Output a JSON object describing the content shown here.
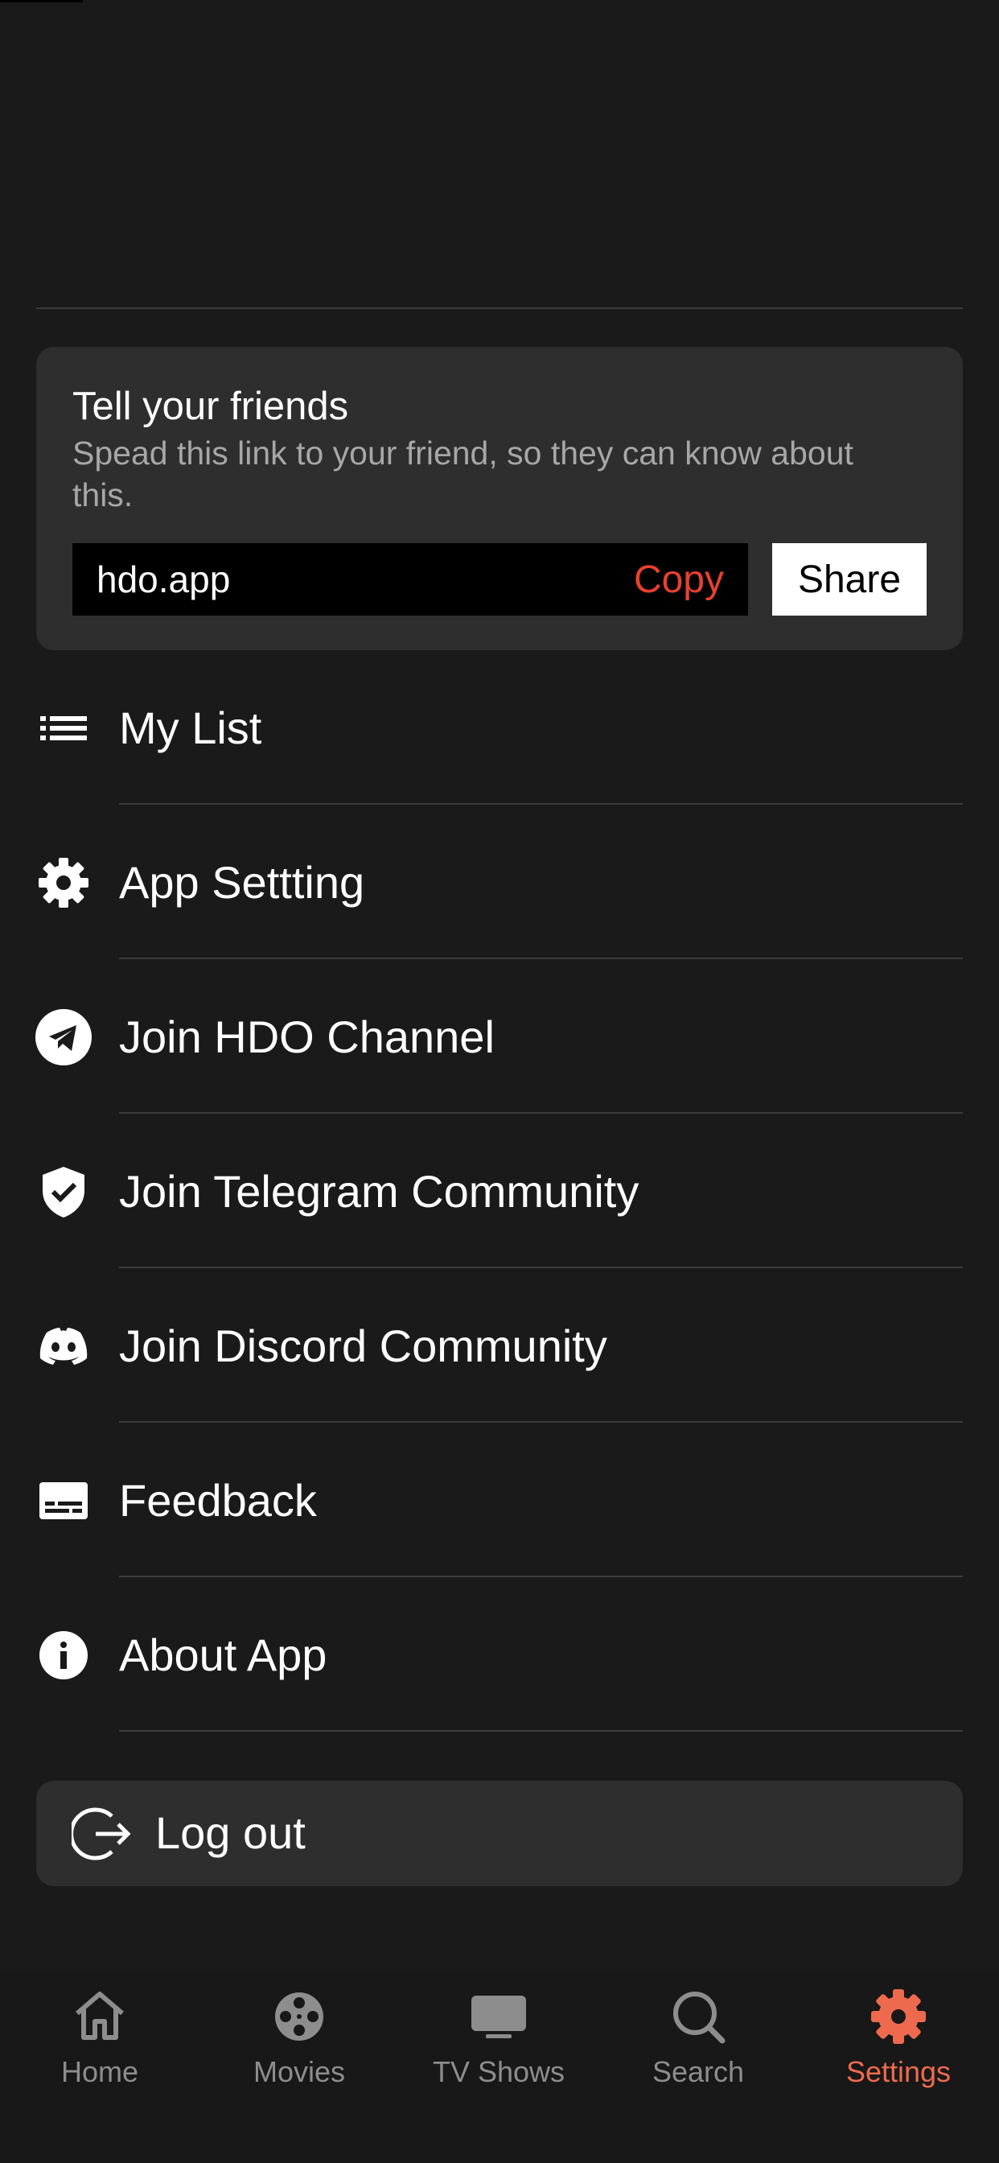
{
  "share_card": {
    "title": "Tell your friends",
    "subtitle": "Spead this link to your friend, so they can know about this.",
    "link": "hdo.app",
    "copy_label": "Copy",
    "share_label": "Share"
  },
  "menu": {
    "items": [
      {
        "label": "My List",
        "icon": "list-icon"
      },
      {
        "label": "App Settting",
        "icon": "gear-icon"
      },
      {
        "label": "Join HDO Channel",
        "icon": "telegram-icon"
      },
      {
        "label": "Join Telegram Community",
        "icon": "shield-check-icon"
      },
      {
        "label": "Join Discord Community",
        "icon": "discord-icon"
      },
      {
        "label": "Feedback",
        "icon": "subtitles-icon"
      },
      {
        "label": "About App",
        "icon": "info-icon"
      }
    ]
  },
  "logout": {
    "label": "Log out",
    "icon": "logout-icon"
  },
  "tabbar": {
    "tabs": [
      {
        "label": "Home",
        "icon": "home-icon",
        "active": false
      },
      {
        "label": "Movies",
        "icon": "film-reel-icon",
        "active": false
      },
      {
        "label": "TV Shows",
        "icon": "tv-icon",
        "active": false
      },
      {
        "label": "Search",
        "icon": "search-icon",
        "active": false
      },
      {
        "label": "Settings",
        "icon": "gear-icon",
        "active": true
      }
    ]
  },
  "colors": {
    "background": "#1a1a1a",
    "card": "#2e2e2e",
    "accent": "#ee6a4e",
    "copy": "#e8412e",
    "inactive_tab": "#8d8d8d"
  }
}
